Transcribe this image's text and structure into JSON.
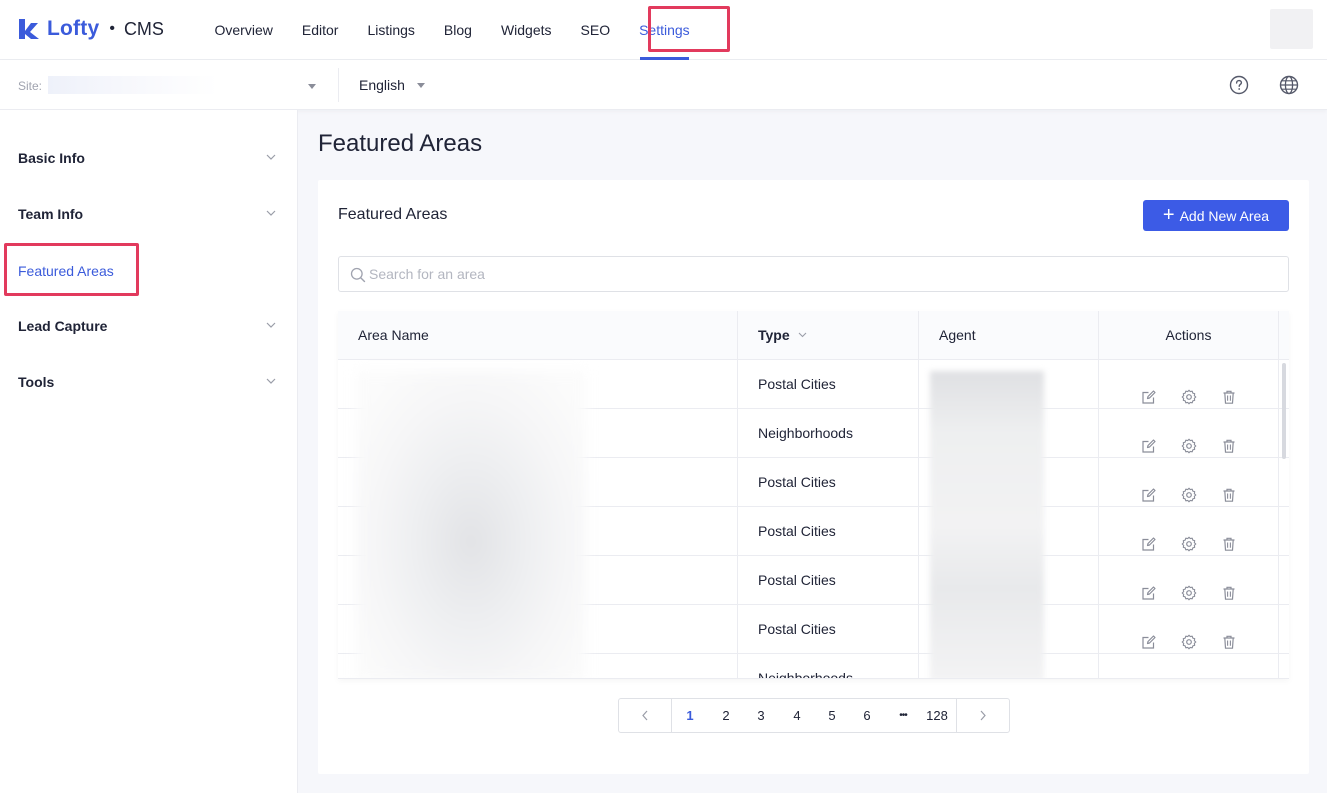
{
  "app": {
    "brand": "Lofty",
    "product": "CMS",
    "separator": "•"
  },
  "nav": {
    "items": [
      {
        "label": "Overview"
      },
      {
        "label": "Editor"
      },
      {
        "label": "Listings"
      },
      {
        "label": "Blog"
      },
      {
        "label": "Widgets"
      },
      {
        "label": "SEO"
      },
      {
        "label": "Settings",
        "active": true
      }
    ]
  },
  "subbar": {
    "site_label": "Site:",
    "language": "English"
  },
  "sidebar": {
    "items": [
      {
        "label": "Basic Info",
        "expandable": true
      },
      {
        "label": "Team Info",
        "expandable": true
      },
      {
        "label": "Featured Areas",
        "active": true
      },
      {
        "label": "Lead Capture",
        "expandable": true
      },
      {
        "label": "Tools",
        "expandable": true
      }
    ]
  },
  "main": {
    "page_title": "Featured Areas",
    "card_title": "Featured Areas",
    "add_button": "Add New Area",
    "search": {
      "placeholder": "Search for an area",
      "value": ""
    },
    "table": {
      "columns": [
        "Area Name",
        "Type",
        "Agent",
        "Actions"
      ],
      "rows": [
        {
          "type": "Postal Cities"
        },
        {
          "type": "Neighborhoods"
        },
        {
          "type": "Postal Cities"
        },
        {
          "type": "Postal Cities"
        },
        {
          "type": "Postal Cities"
        },
        {
          "type": "Postal Cities"
        },
        {
          "type": "Neighborhoods"
        }
      ]
    },
    "pagination": {
      "pages": [
        "1",
        "2",
        "3",
        "4",
        "5",
        "6"
      ],
      "ellipsis": "•••",
      "last": "128",
      "current": "1"
    }
  },
  "colors": {
    "accent": "#3b5bdb",
    "button": "#3c5be6",
    "highlight": "#e23a5d"
  }
}
